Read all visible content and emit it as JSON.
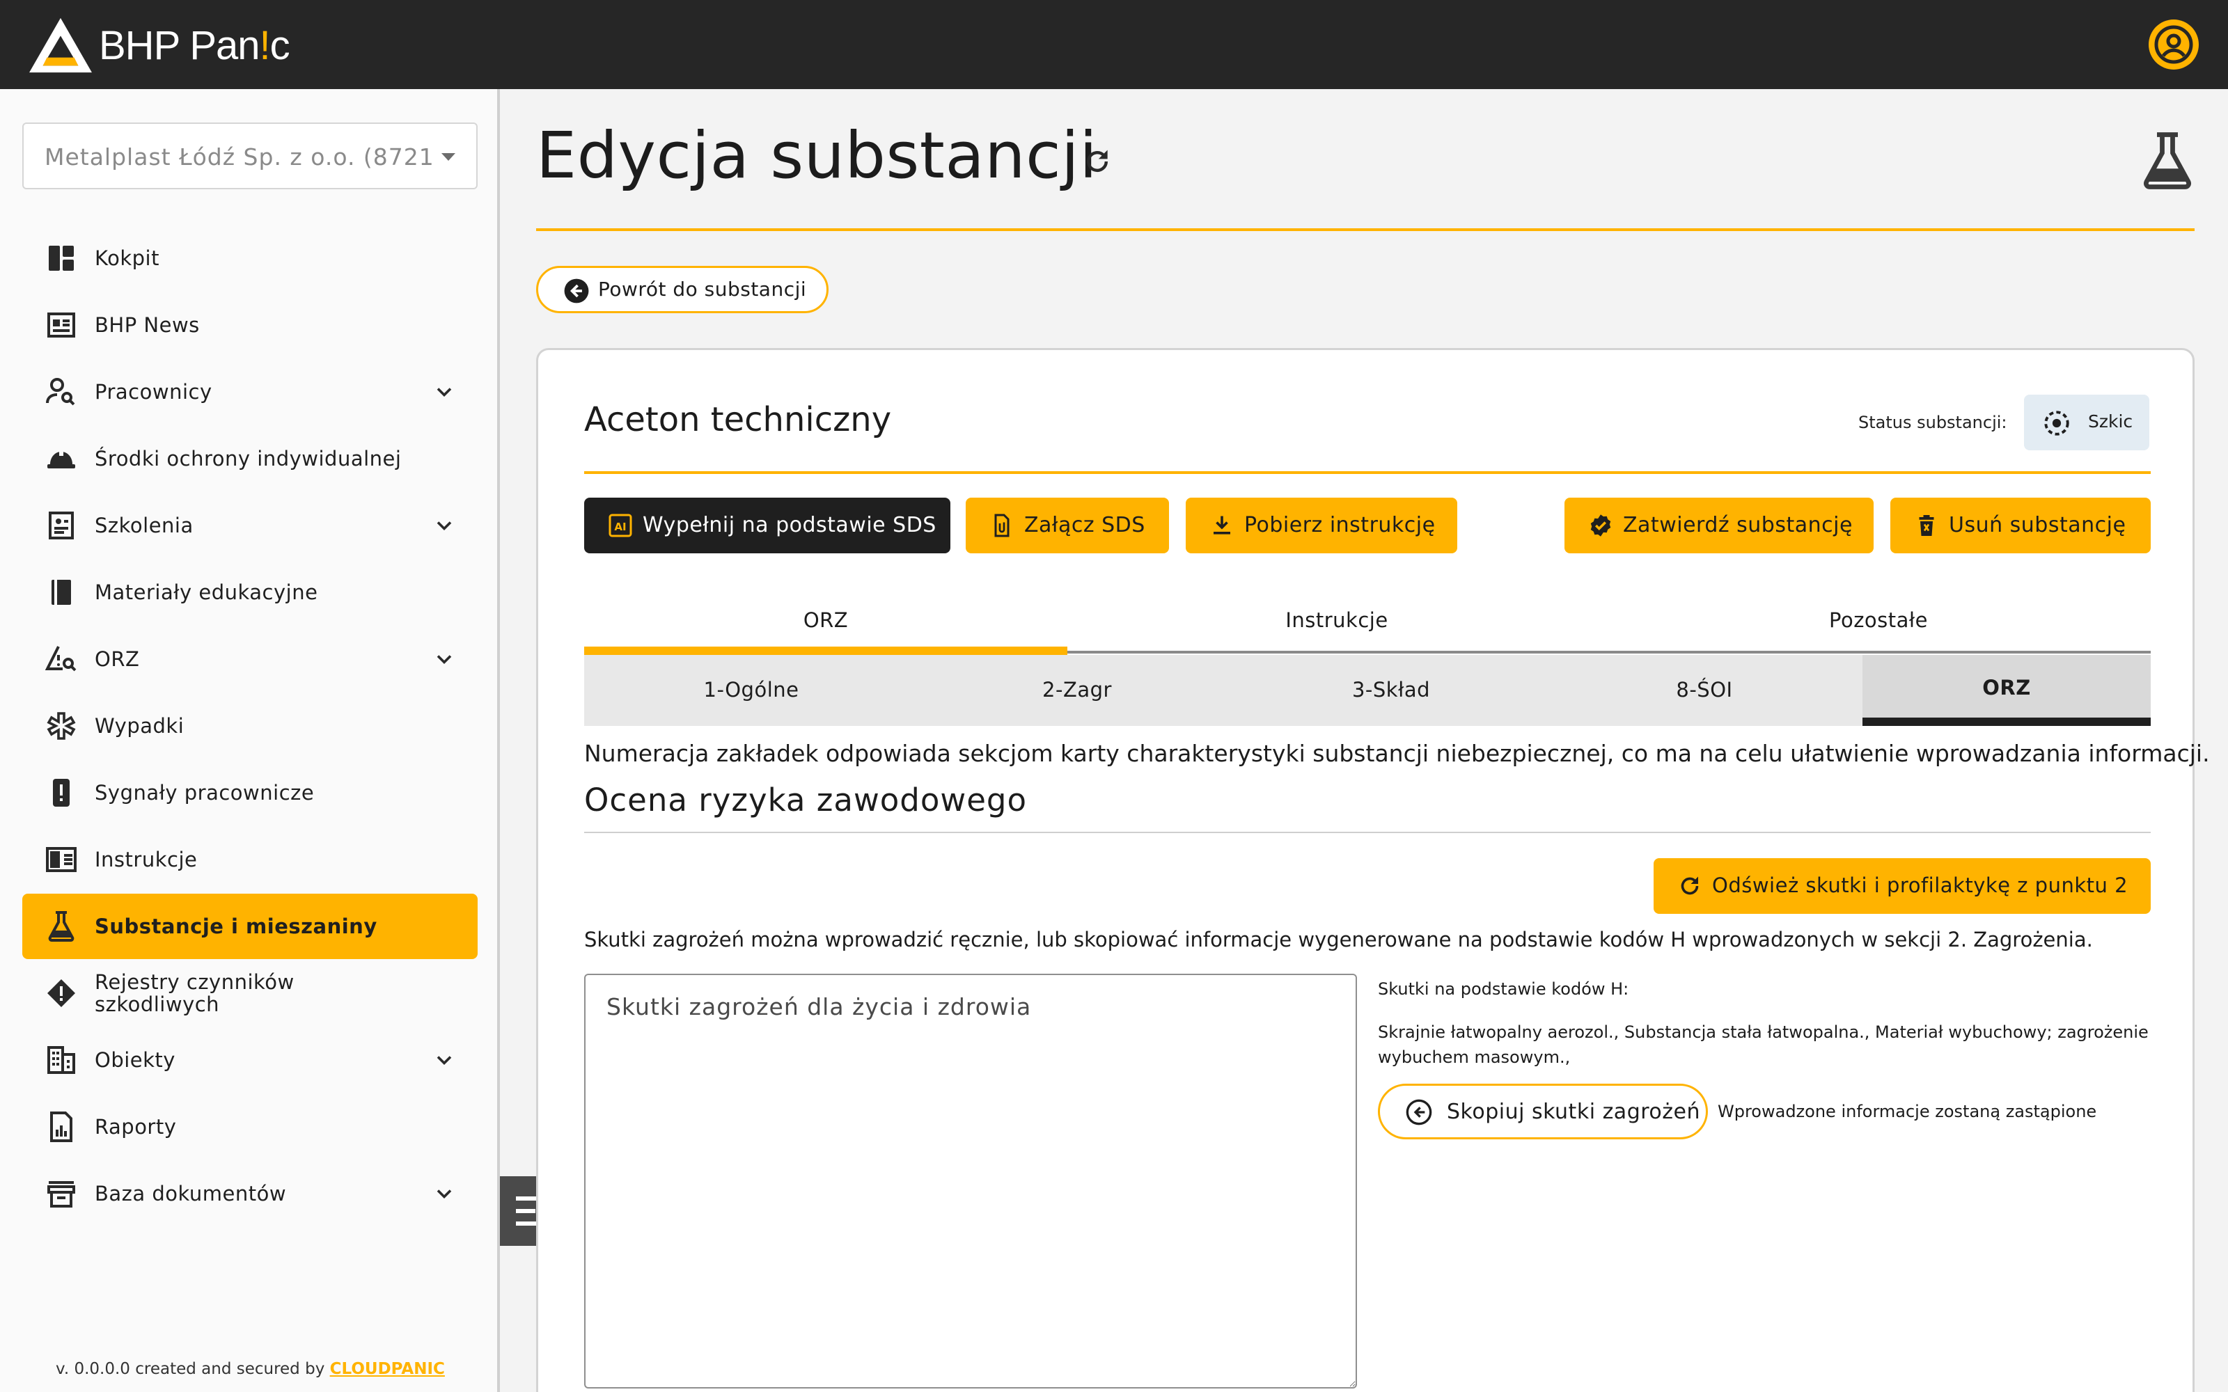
{
  "app": {
    "brand": "BHP Pan",
    "brand_accent": "!",
    "brand_end": "c",
    "accent_color": "#ffb300",
    "dark_color": "#262626"
  },
  "sidebar": {
    "company_select": "Metalplast Łódź Sp. z o.o. (8721...",
    "items": [
      {
        "label": "Kokpit",
        "icon": "dashboard-icon",
        "expandable": false,
        "active": false
      },
      {
        "label": "BHP News",
        "icon": "news-icon",
        "expandable": false,
        "active": false
      },
      {
        "label": "Pracownicy",
        "icon": "person-search-icon",
        "expandable": true,
        "active": false
      },
      {
        "label": "Środki ochrony indywidualnej",
        "icon": "helmet-icon",
        "expandable": false,
        "active": false
      },
      {
        "label": "Szkolenia",
        "icon": "training-icon",
        "expandable": true,
        "active": false
      },
      {
        "label": "Materiały edukacyjne",
        "icon": "book-icon",
        "expandable": false,
        "active": false
      },
      {
        "label": "ORZ",
        "icon": "warning-search-icon",
        "expandable": true,
        "active": false
      },
      {
        "label": "Wypadki",
        "icon": "medical-icon",
        "expandable": false,
        "active": false
      },
      {
        "label": "Sygnały pracownicze",
        "icon": "alert-icon",
        "expandable": false,
        "active": false
      },
      {
        "label": "Instrukcje",
        "icon": "instructions-icon",
        "expandable": false,
        "active": false
      },
      {
        "label": "Substancje i mieszaniny",
        "icon": "flask-icon",
        "expandable": false,
        "active": true
      },
      {
        "label": "Rejestry czynników szkodliwych",
        "icon": "hazard-icon",
        "expandable": false,
        "active": false
      },
      {
        "label": "Obiekty",
        "icon": "building-icon",
        "expandable": true,
        "active": false
      },
      {
        "label": "Raporty",
        "icon": "report-icon",
        "expandable": false,
        "active": false
      },
      {
        "label": "Baza dokumentów",
        "icon": "archive-icon",
        "expandable": true,
        "active": false
      }
    ],
    "footer_prefix": "v. 0.0.0.0 created and secured by ",
    "footer_link": "CLOUDPANIC"
  },
  "header": {
    "title": "Edycja substancji",
    "back_label": "Powrót do substancji"
  },
  "card": {
    "substance_name": "Aceton techniczny",
    "status_label": "Status substancji:",
    "status_value": "Szkic",
    "actions": {
      "fill_sds": "Wypełnij na podstawie SDS",
      "attach_sds": "Załącz SDS",
      "download_instruction": "Pobierz instrukcję",
      "approve": "Zatwierdź substancję",
      "delete": "Usuń substancję"
    },
    "main_tabs": [
      "ORZ",
      "Instrukcje",
      "Pozostałe"
    ],
    "section_tabs": [
      "1-Ogólne",
      "2-Zagr",
      "3-Skład",
      "8-ŚOI",
      "ORZ"
    ],
    "note": "Numeracja zakładek odpowiada sekcjom karty charakterystyki substancji niebezpiecznej, co ma na celu ułatwienie wprowadzania informacji.",
    "section_title": "Ocena ryzyka zawodowego",
    "refresh_button": "Odśwież skutki i profilaktykę z punktu 2",
    "info": "Skutki zagrożeń można wprowadzić ręcznie, lub skopiować informacje wygenerowane na podstawie kodów H wprowadzonych w sekcji 2. Zagrożenia.",
    "textarea_placeholder": "Skutki zagrożeń dla życia i zdrowia",
    "hcodes_label": "Skutki na podstawie kodów H:",
    "hcodes_text": "Skrajnie łatwopalny aerozol., Substancja stała łatwopalna., Materiał wybuchowy; zagrożenie wybuchem masowym.,",
    "copy_button": "Skopiuj skutki zagrożeń",
    "replace_note": "Wprowadzone informacje zostaną zastąpione"
  }
}
